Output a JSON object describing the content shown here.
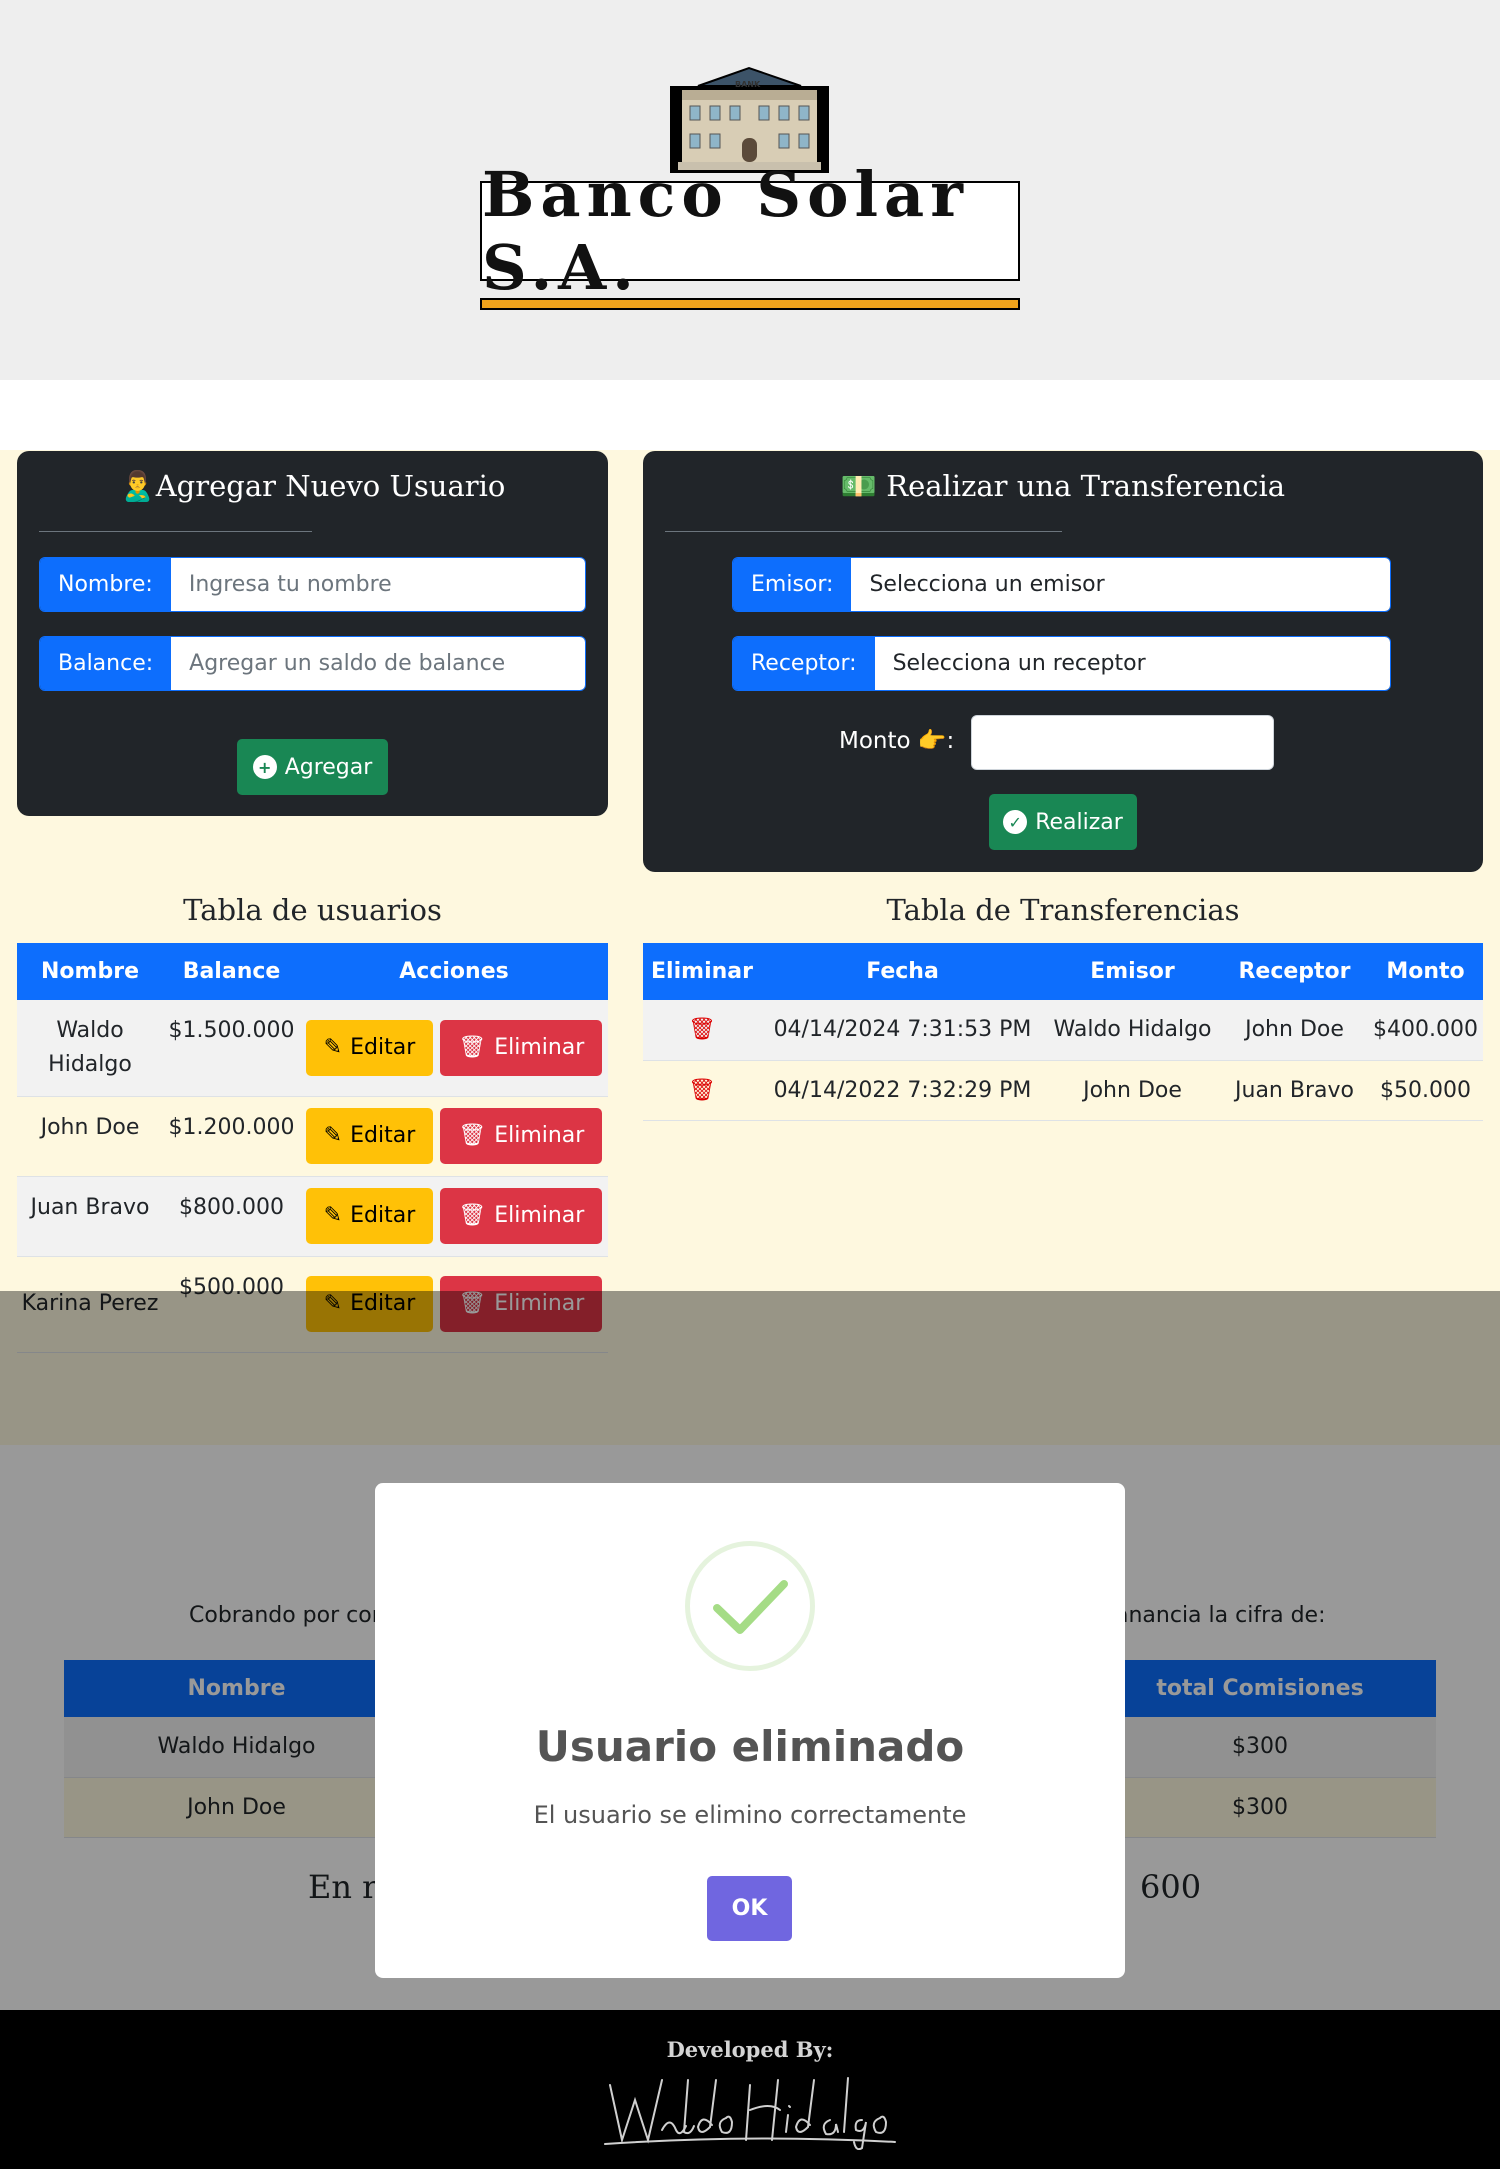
{
  "header": {
    "brand": "Banco Solar S.A.",
    "bank_icon_label": "BANK"
  },
  "add_user": {
    "title_icon": "🙎‍♂️",
    "title": "Agregar Nuevo Usuario",
    "name_label": "Nombre:",
    "name_placeholder": "Ingresa tu nombre",
    "balance_label": "Balance:",
    "balance_placeholder": "Agregar un saldo de balance",
    "submit_label": "Agregar"
  },
  "transfer": {
    "title_icon": "💵",
    "title": "Realizar una Transferencia",
    "sender_label": "Emisor:",
    "sender_value": "Selecciona un emisor",
    "receiver_label": "Receptor:",
    "receiver_value": "Selecciona un receptor",
    "amount_label": "Monto 👉:",
    "submit_label": "Realizar"
  },
  "users_table": {
    "title": "Tabla de usuarios",
    "headers": [
      "Nombre",
      "Balance",
      "Acciones"
    ],
    "edit_label": "Editar",
    "delete_label": "Eliminar",
    "rows": [
      {
        "name": "Waldo Hidalgo",
        "balance": "$1.500.000"
      },
      {
        "name": "John Doe",
        "balance": "$1.200.000"
      },
      {
        "name": "Juan Bravo",
        "balance": "$800.000"
      },
      {
        "name": "Karina Perez",
        "balance": "$500.000"
      }
    ]
  },
  "transfers_table": {
    "title": "Tabla de Transferencias",
    "headers": [
      "Eliminar",
      "Fecha",
      "Emisor",
      "Receptor",
      "Monto"
    ],
    "rows": [
      {
        "date": "04/14/2024 7:31:53 PM",
        "sender": "Waldo Hidalgo",
        "receiver": "John Doe",
        "amount": "$400.000"
      },
      {
        "date": "04/14/2022 7:32:29 PM",
        "sender": "John Doe",
        "receiver": "Juan Bravo",
        "amount": "$50.000"
      }
    ]
  },
  "commissions": {
    "intro_left": "Cobrando por con",
    "intro_right": "anancia la cifra de:",
    "headers": {
      "name": "Nombre",
      "total": "total Comisiones"
    },
    "rows": [
      {
        "name": "Waldo Hidalgo",
        "total": "$300"
      },
      {
        "name": "John Doe",
        "total": "$300"
      }
    ],
    "summary_left": "En re",
    "summary_right": "600"
  },
  "footer": {
    "developed_by": "Developed By:"
  },
  "modal": {
    "title": "Usuario eliminado",
    "message": "El usuario se elimino correctamente",
    "ok_label": "OK"
  },
  "colors": {
    "primary": "#0d6efd",
    "success": "#198754",
    "warning": "#ffc107",
    "danger": "#dc3545",
    "card_dark": "#212529",
    "modal_button": "#7066e0"
  }
}
